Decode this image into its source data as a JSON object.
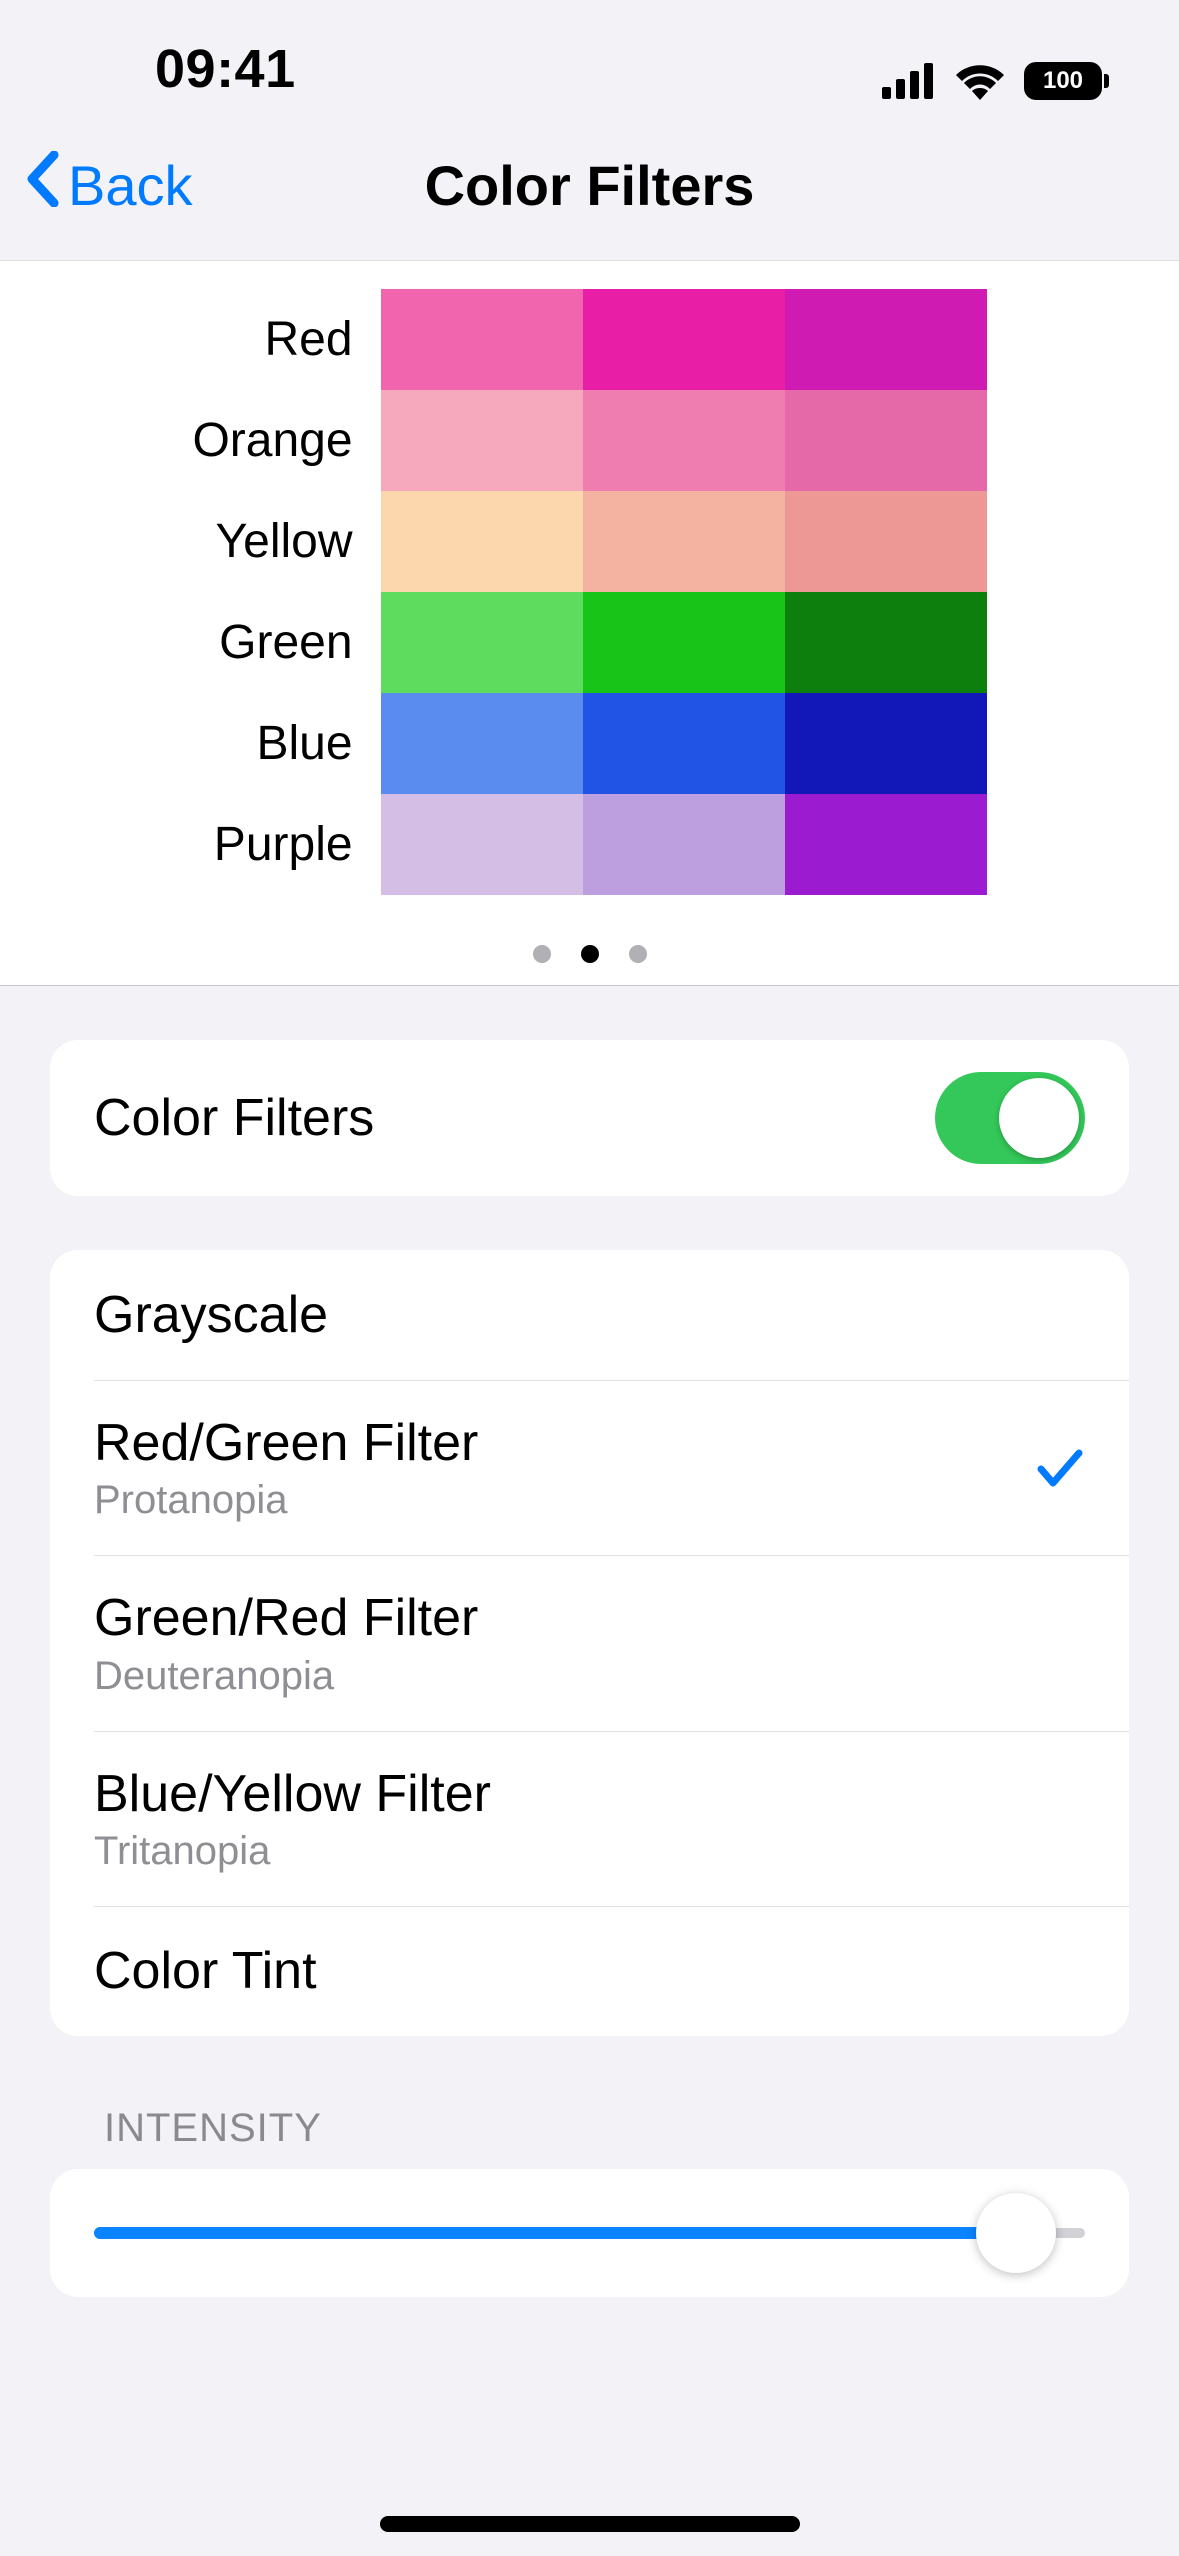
{
  "status": {
    "time": "09:41",
    "battery": "100"
  },
  "nav": {
    "back_label": "Back",
    "title": "Color Filters"
  },
  "preview": {
    "labels": [
      "Red",
      "Orange",
      "Yellow",
      "Green",
      "Blue",
      "Purple"
    ],
    "swatches": [
      [
        "#f065ad",
        "#e81ea7",
        "#cf1bb1"
      ],
      [
        "#f6a8bd",
        "#ef7db0",
        "#e568a9"
      ],
      [
        "#fcd7ad",
        "#f4b3a0",
        "#ee9895"
      ],
      [
        "#5edc5e",
        "#19c419",
        "#0d7f0d"
      ],
      [
        "#5a8cf0",
        "#2154e4",
        "#1218b7"
      ],
      [
        "#d4bee6",
        "#bd9ede",
        "#9b1bd1"
      ]
    ],
    "page_count": 3,
    "active_page": 1
  },
  "toggle": {
    "label": "Color Filters",
    "enabled": true
  },
  "filters": [
    {
      "title": "Grayscale",
      "sub": null,
      "selected": false
    },
    {
      "title": "Red/Green Filter",
      "sub": "Protanopia",
      "selected": true
    },
    {
      "title": "Green/Red Filter",
      "sub": "Deuteranopia",
      "selected": false
    },
    {
      "title": "Blue/Yellow Filter",
      "sub": "Tritanopia",
      "selected": false
    },
    {
      "title": "Color Tint",
      "sub": null,
      "selected": false
    }
  ],
  "intensity": {
    "header": "INTENSITY",
    "value_percent": 93
  }
}
